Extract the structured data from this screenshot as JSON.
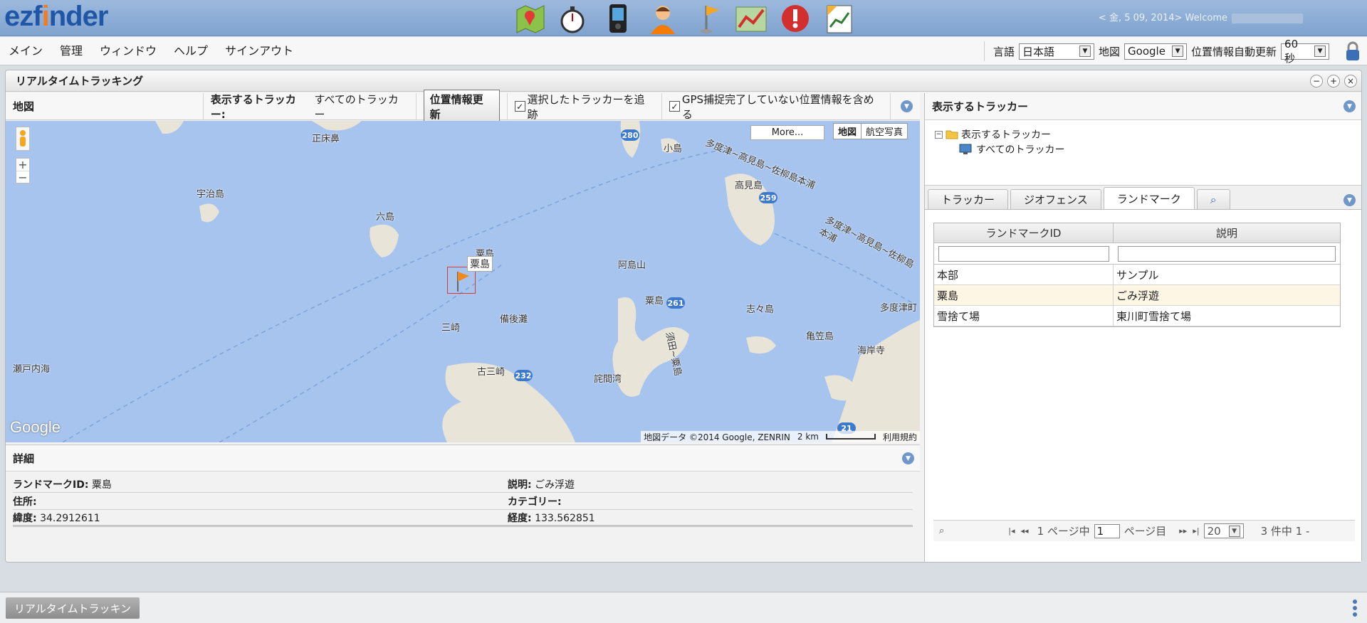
{
  "brand": {
    "logo_pre": "ezf",
    "logo_o": "i",
    "logo_post": "nder"
  },
  "header": {
    "welcome": "< 金, 5 09, 2014> Welcome"
  },
  "app_icons": [
    "map-icon",
    "stopwatch-icon",
    "device-icon",
    "user-icon",
    "flag-icon",
    "route-icon",
    "alert-icon",
    "report-icon"
  ],
  "menu": [
    "メイン",
    "管理",
    "ウィンドウ",
    "ヘルプ",
    "サインアウト"
  ],
  "settings": {
    "lang_label": "言語",
    "lang_value": "日本語",
    "map_label": "地図",
    "map_value": "Google",
    "refresh_label": "位置情報自動更新",
    "refresh_value": "60 秒"
  },
  "panel": {
    "title": "リアルタイムトラッキング"
  },
  "map_toolbar": {
    "map_label": "地図",
    "tracker_label": "表示するトラッカー:",
    "tracker_value": "すべてのトラッカー",
    "refresh_button": "位置情報更新",
    "follow_label": "選択したトラッカーを追跡",
    "gps_label": "GPS捕捉完了していない位置情報を含める"
  },
  "map": {
    "more": "More...",
    "type_map": "地図",
    "type_sat": "航空写真",
    "labels": [
      "正床鼻",
      "宇治島",
      "六島",
      "粟島",
      "阿島山",
      "粟島",
      "備後灘",
      "三崎",
      "古三崎",
      "瀬戸内海",
      "小島",
      "高見島",
      "多度津~高見島~佐柳島本浦",
      "多度津~高見島~佐柳島本浦",
      "志々島",
      "亀笠島",
      "海岸寺",
      "多度津町",
      "須田~粟島",
      "詫間湾"
    ],
    "roads": [
      "280",
      "259",
      "261",
      "232",
      "21"
    ],
    "marker_label": "粟島",
    "attribution": "地図データ ©2014 Google, ZENRIN",
    "scale": "2 km",
    "terms": "利用規約",
    "google": "Google"
  },
  "detail": {
    "title": "詳細",
    "landmark_id_label": "ランドマークID:",
    "landmark_id": "粟島",
    "desc_label": "説明:",
    "desc": "ごみ浮遊",
    "address_label": "住所:",
    "category_label": "カテゴリー:",
    "lat_label": "緯度:",
    "lat": "34.2912611",
    "lng_label": "経度:",
    "lng": "133.562851"
  },
  "right": {
    "title": "表示するトラッカー",
    "tree_root": "表示するトラッカー",
    "tree_child": "すべてのトラッカー",
    "tabs": [
      "トラッカー",
      "ジオフェンス",
      "ランドマーク"
    ],
    "columns": [
      "ランドマークID",
      "説明"
    ],
    "rows": [
      [
        "本部",
        "サンプル"
      ],
      [
        "粟島",
        "ごみ浮遊"
      ],
      [
        "雪捨て場",
        "東川町雪捨て場"
      ]
    ],
    "pager": {
      "page_pre": "1 ページ中",
      "page_value": "1",
      "page_post": "ページ目",
      "size": "20",
      "count": "3 件中 1 -"
    }
  },
  "taskbar": {
    "item": "リアルタイムトラッキン"
  }
}
